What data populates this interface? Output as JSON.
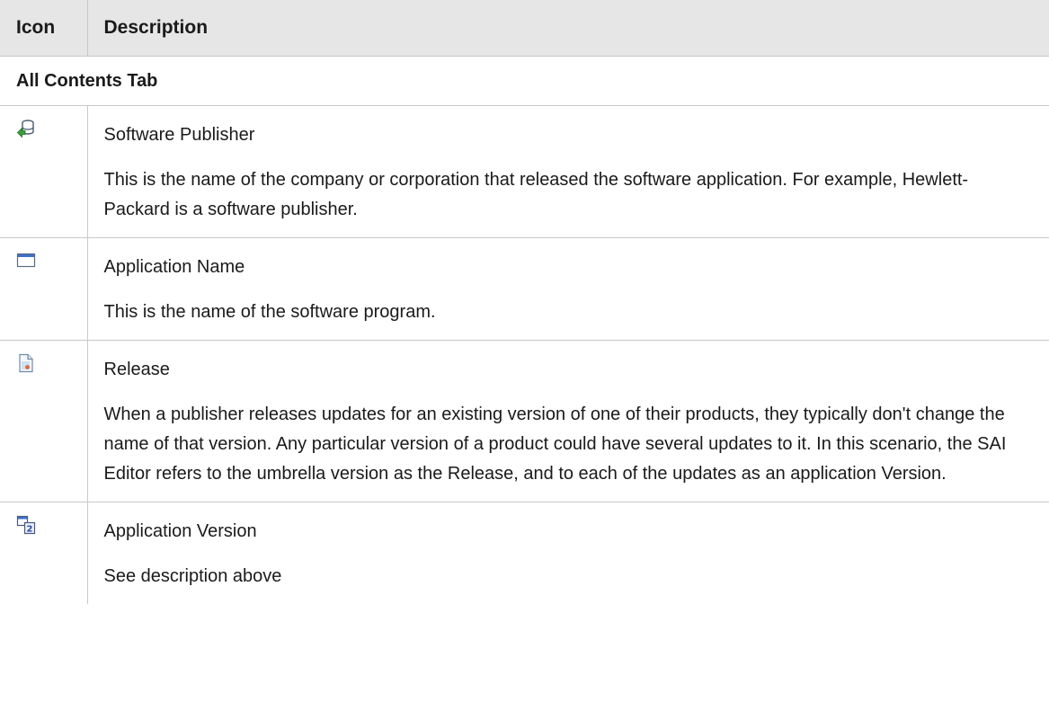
{
  "table": {
    "headers": {
      "icon": "Icon",
      "description": "Description"
    },
    "section_title": "All Contents Tab",
    "rows": [
      {
        "icon": "software-publisher-icon",
        "title": "Software Publisher",
        "description": "This is the name of the company or corporation that released the software application. For example, Hewlett-Packard is a software publisher."
      },
      {
        "icon": "application-window-icon",
        "title": "Application Name",
        "description": "This is the name of the software program."
      },
      {
        "icon": "release-document-icon",
        "title": "Release",
        "description": "When a publisher releases updates for an existing version of one of their products, they typically don't change the name of that version. Any particular version of a product could have several updates to it. In this scenario, the SAI Editor refers to the umbrella version as the Release, and to each of the updates as an application Version."
      },
      {
        "icon": "application-version-icon",
        "title": "Application Version",
        "description": "See description above"
      }
    ]
  },
  "colors": {
    "header_background": "#e6e6e6",
    "border": "#c8c8c8",
    "text": "#1a1a1a"
  }
}
